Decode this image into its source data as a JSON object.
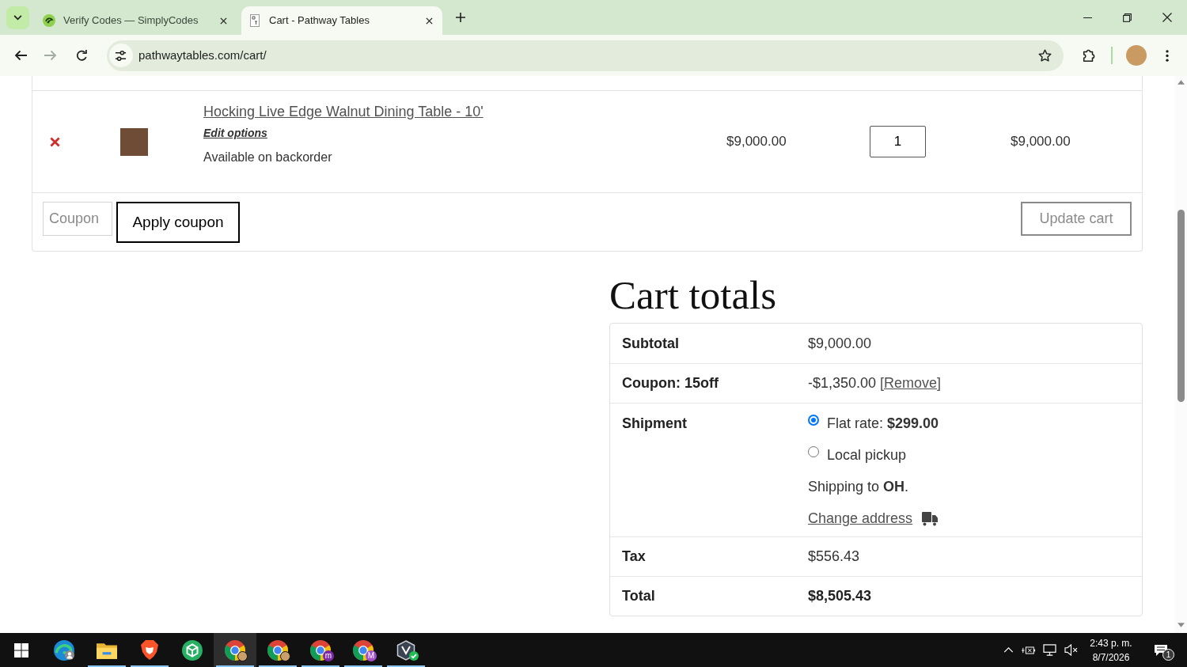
{
  "browser": {
    "tabs": [
      {
        "title": "Verify Codes — SimplyCodes",
        "kind": "swirl",
        "selected": false
      },
      {
        "title": "Cart - Pathway Tables",
        "kind": "page",
        "selected": true
      }
    ],
    "address": "pathwaytables.com/cart/"
  },
  "cart": {
    "items": [
      {
        "name": "Hocking Live Edge Walnut Dining Table - 10'",
        "edit_link": "Edit options",
        "availability": "Available on backorder",
        "price": "$9,000.00",
        "quantity": "1",
        "subtotal": "$9,000.00"
      }
    ],
    "coupon": {
      "placeholder": "Coupon",
      "button": "Apply coupon"
    },
    "update_button": {
      "label": "Update cart",
      "disabled": true
    }
  },
  "cart_totals": {
    "title": "Cart totals",
    "rows": [
      {
        "kind": "amount",
        "label": "Subtotal",
        "value": "$9,000.00"
      },
      {
        "kind": "coupon",
        "label": "Coupon: 15off",
        "value": "-$1,350.00",
        "link": "[Remove]"
      },
      {
        "kind": "shipping",
        "label": "Shipment",
        "options": [
          {
            "label": "Flat rate: **$299.00**",
            "selected": true
          },
          {
            "label": "Local pickup",
            "selected": false
          }
        ],
        "destination": "Shipping to **OH**.",
        "link": "Change address"
      },
      {
        "kind": "amount",
        "label": "Tax",
        "value": "$556.43"
      },
      {
        "kind": "total",
        "label": "Total",
        "value": "$8,505.43"
      }
    ]
  },
  "taskbar": {
    "apps": [
      {
        "kind": "edge",
        "running": false,
        "selected": false,
        "badge": {
          "kind": "person"
        }
      },
      {
        "kind": "folder",
        "running": true,
        "selected": false
      },
      {
        "kind": "brave",
        "running": true,
        "selected": false
      },
      {
        "kind": "cube",
        "running": false,
        "selected": false
      },
      {
        "kind": "chrome",
        "running": true,
        "selected": true,
        "badge": {
          "kind": "photo"
        }
      },
      {
        "kind": "chrome",
        "running": true,
        "selected": false,
        "badge": {
          "kind": "photo"
        }
      },
      {
        "kind": "chrome",
        "running": true,
        "selected": false,
        "badge": {
          "kind": "letter",
          "text": "m",
          "color": "#7b2aa6"
        }
      },
      {
        "kind": "chrome",
        "running": true,
        "selected": false,
        "badge": {
          "kind": "letter",
          "text": "M",
          "color": "#a04fc8"
        }
      },
      {
        "kind": "shield",
        "running": true,
        "selected": false,
        "badge": {
          "kind": "check"
        }
      }
    ],
    "clock_time": "2:43 p. m.",
    "clock_date": "8/7/2026",
    "notification_count": "1"
  }
}
